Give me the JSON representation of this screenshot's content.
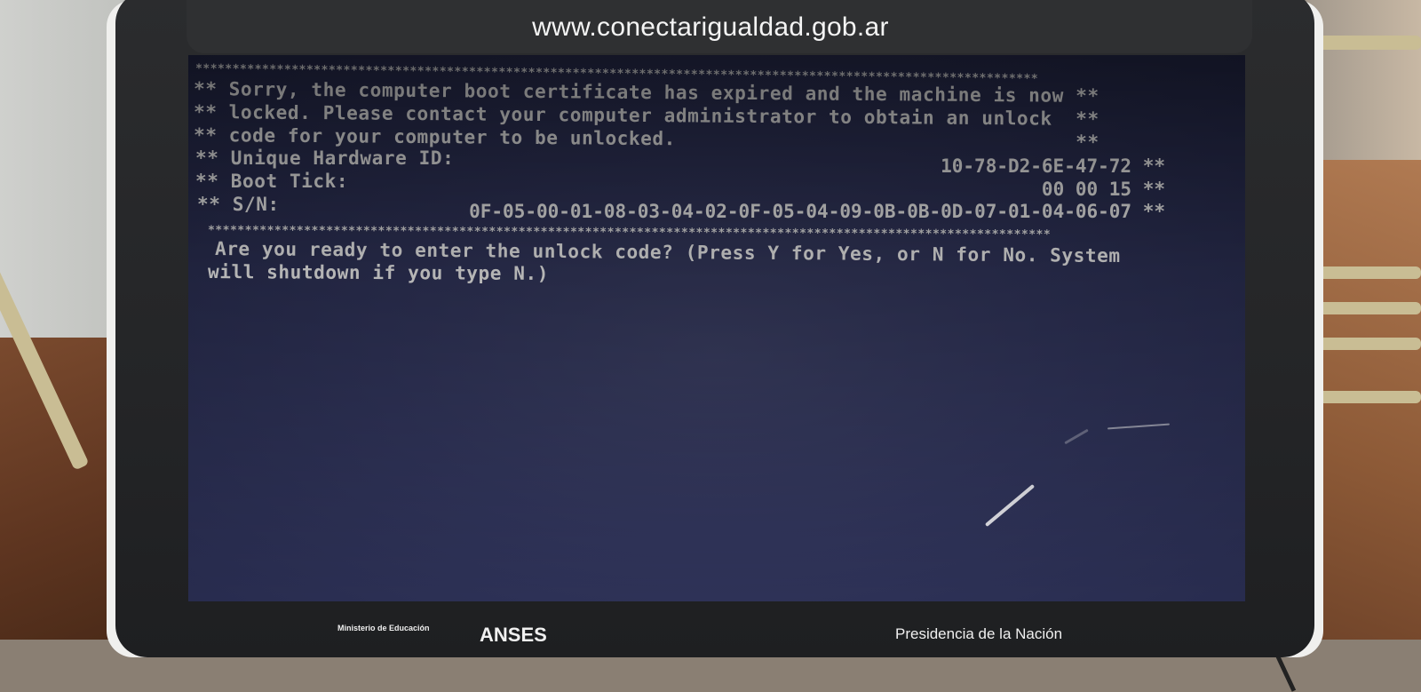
{
  "bezel": {
    "url": "www.conectarigualdad.gob.ar"
  },
  "terminal": {
    "border": "******************************************************************************************************************",
    "lines": [
      "** Sorry, the computer boot certificate has expired and the machine is now **",
      "** locked. Please contact your computer administrator to obtain an unlock  **",
      "** code for your computer to be unlocked.                                  **"
    ],
    "hardware_label": "** Unique Hardware ID:",
    "hardware_value": "10-78-D2-6E-47-72 **",
    "boot_tick_label": "** Boot Tick:",
    "boot_tick_value": "00 00 15 **",
    "sn_label": "** S/N:",
    "sn_value": "0F-05-00-01-08-03-04-02-0F-05-04-09-0B-0B-0D-07-01-04-06-07 **",
    "prompt_line1": "Are you ready to enter the unlock code? (Press Y for Yes, or N for No. System",
    "prompt_line2": "will shutdown if you type N.)"
  },
  "footer_logos": {
    "ministry": "Ministerio de Educación",
    "anses": "ANSES",
    "presidencia": "Presidencia de la Nación"
  },
  "colors": {
    "screen_bg": "#30345a",
    "text": "#f2f2f2",
    "bezel": "#2b2c2e"
  }
}
